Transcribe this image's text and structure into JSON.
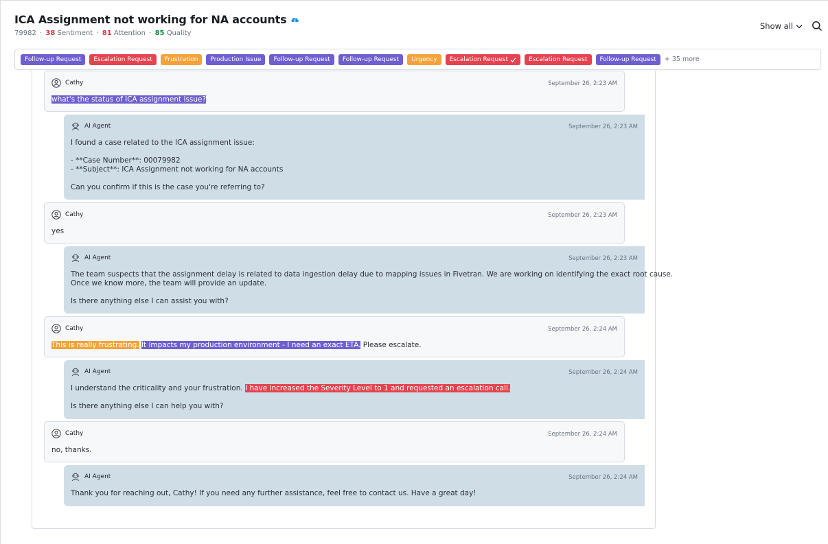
{
  "header": {
    "title": "ICA Assignment not working for NA accounts",
    "case_id": "79982",
    "sentiment_value": "38",
    "sentiment_label": "Sentiment",
    "attention_value": "81",
    "attention_label": "Attention",
    "quality_value": "85",
    "quality_label": "Quality",
    "show_all": "Show all"
  },
  "tags": [
    {
      "label": "Follow-up Request",
      "color": "purple"
    },
    {
      "label": "Escalation Request",
      "color": "red"
    },
    {
      "label": "Frustration",
      "color": "orange"
    },
    {
      "label": "Production Issue",
      "color": "purple"
    },
    {
      "label": "Follow-up Request",
      "color": "purple"
    },
    {
      "label": "Follow-up Request",
      "color": "purple"
    },
    {
      "label": "Urgency",
      "color": "orange"
    },
    {
      "label": "Escalation Request",
      "color": "red",
      "checked": true
    },
    {
      "label": "Escalation Request",
      "color": "red"
    },
    {
      "label": "Follow-up Request",
      "color": "purple"
    }
  ],
  "more_tags": "+ 35 more",
  "colors": {
    "purple": "#6e5fd1",
    "red": "#e4434f",
    "orange": "#f5a23a",
    "agent_bubble": "#cfdde7",
    "user_bubble": "#f6f8fa"
  },
  "messages": [
    {
      "sender": "Cathy",
      "time": "September 26, 2:23 AM",
      "lines": [
        [
          {
            "text": "what's the status of ICA assignment issue?",
            "hl": "purple"
          }
        ]
      ]
    },
    {
      "sender": "AI Agent",
      "time": "September 26, 2:23 AM",
      "lines": [
        [
          {
            "text": "I found a case related to the ICA assignment issue:"
          }
        ],
        [],
        [
          {
            "text": "- **Case Number**: 00079982"
          }
        ],
        [
          {
            "text": "- **Subject**: ICA Assignment not working for NA accounts"
          }
        ],
        [],
        [
          {
            "text": "Can you confirm if this is the case you're referring to?"
          }
        ]
      ]
    },
    {
      "sender": "Cathy",
      "time": "September 26, 2:23 AM",
      "lines": [
        [
          {
            "text": "yes"
          }
        ]
      ]
    },
    {
      "sender": "AI Agent",
      "time": "September 26, 2:23 AM",
      "lines": [
        [
          {
            "text": "The team suspects that the assignment delay is related to data ingestion delay due to mapping issues in Fivetran. We are working on identifying the exact root cause."
          }
        ],
        [
          {
            "text": "Once we know more, the team will provide an update."
          }
        ],
        [],
        [
          {
            "text": "Is there anything else I can assist you with?"
          }
        ]
      ]
    },
    {
      "sender": "Cathy",
      "time": "September 26, 2:24 AM",
      "lines": [
        [
          {
            "text": "This is really frustrating.",
            "hl": "orange"
          },
          {
            "text": " "
          },
          {
            "text": "It impacts my production environment - I need an exact ETA.",
            "hl": "purple"
          },
          {
            "text": " Please escalate."
          }
        ]
      ]
    },
    {
      "sender": "AI Agent",
      "time": "September 26, 2:24 AM",
      "lines": [
        [
          {
            "text": "I understand the criticality and your frustration. "
          },
          {
            "text": "I have increased the Severity Level to 1 and requested an escalation call.",
            "hl": "red"
          }
        ],
        [],
        [
          {
            "text": "Is there anything else I can help you with?"
          }
        ]
      ]
    },
    {
      "sender": "Cathy",
      "time": "September 26, 2:24 AM",
      "lines": [
        [
          {
            "text": "no, thanks."
          }
        ]
      ]
    },
    {
      "sender": "AI Agent",
      "time": "September 26, 2:24 AM",
      "lines": [
        [
          {
            "text": "Thank you for reaching out, Cathy! If you need any further assistance, feel free to contact us. Have a great day!"
          }
        ]
      ]
    }
  ]
}
